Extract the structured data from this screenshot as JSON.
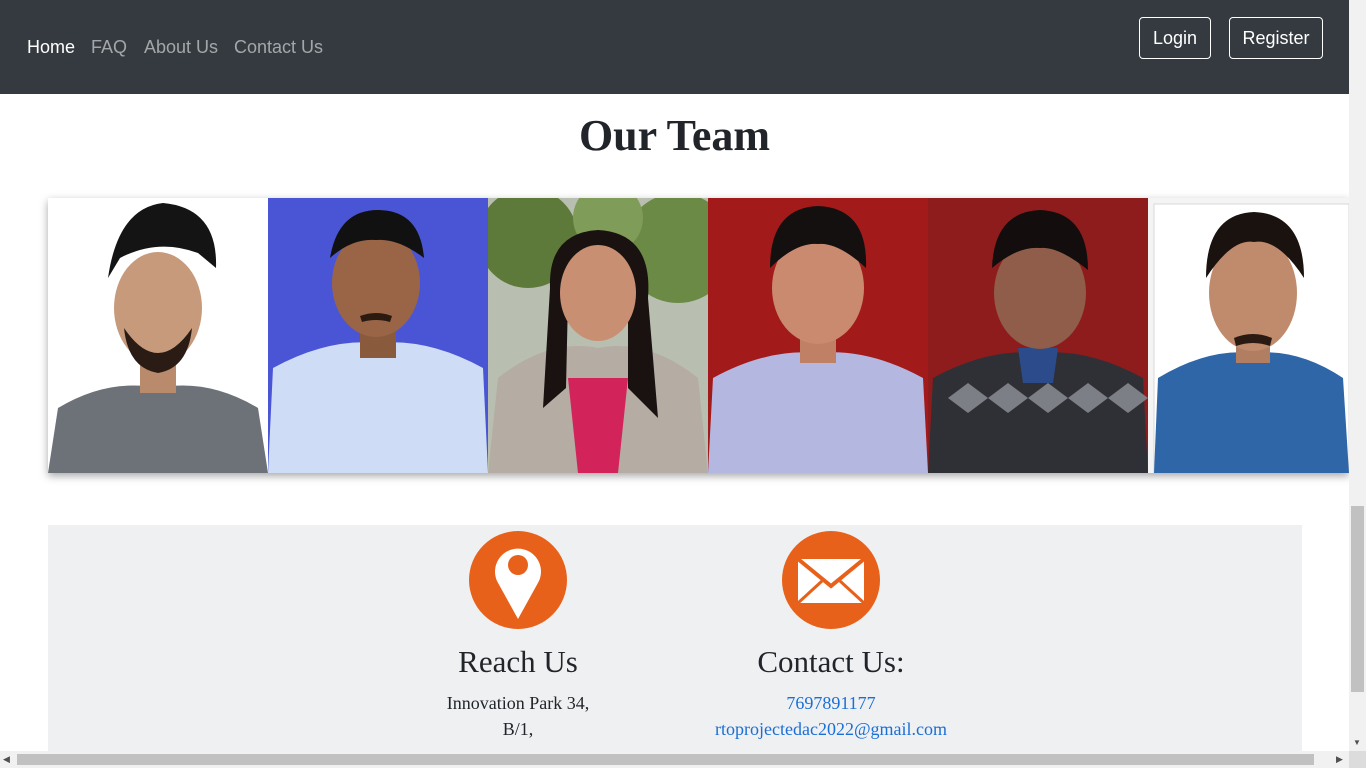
{
  "nav": {
    "links": [
      "Home",
      "FAQ",
      "About Us",
      "Contact Us"
    ],
    "login_label": "Login",
    "register_label": "Register"
  },
  "team": {
    "title": "Our Team"
  },
  "reach": {
    "heading": "Reach Us",
    "lines": [
      "Innovation Park 34,",
      "B/1,"
    ]
  },
  "contact": {
    "heading": "Contact Us:",
    "phone": "7697891177",
    "email": "rtoprojectedac2022@gmail.com"
  },
  "colors": {
    "navbar": "#343a40",
    "accent_orange": "#e8611a",
    "link_blue": "#1a6fd6",
    "footer_bg": "#eff0f2"
  }
}
